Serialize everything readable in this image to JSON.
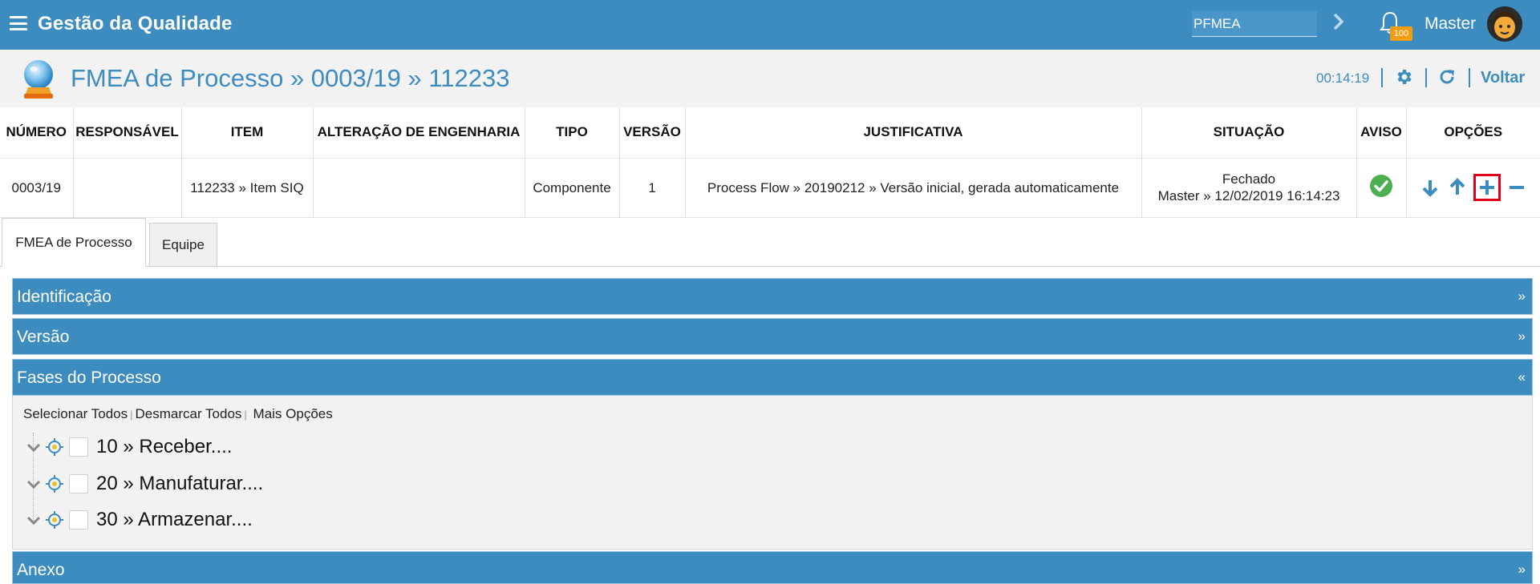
{
  "app": {
    "title": "Gestão da Qualidade",
    "module_value": "PFMEA",
    "notification_count": "100",
    "user_name": "Master"
  },
  "header": {
    "title": "FMEA de Processo » 0003/19 » 112233",
    "timer": "00:14:19",
    "back_label": "Voltar"
  },
  "table": {
    "columns": [
      "NÚMERO",
      "RESPONSÁVEL",
      "ITEM",
      "ALTERAÇÃO DE ENGENHARIA",
      "TIPO",
      "VERSÃO",
      "JUSTIFICATIVA",
      "SITUAÇÃO",
      "AVISO",
      "OPÇÕES"
    ],
    "row": {
      "numero": "0003/19",
      "responsavel": "",
      "item": "112233 » Item SIQ",
      "alteracao": "",
      "tipo": "Componente",
      "versao": "1",
      "justificativa": "Process Flow » 20190212 » Versão inicial, gerada automaticamente",
      "situacao_status": "Fechado",
      "situacao_detail": "Master » 12/02/2019 16:14:23"
    }
  },
  "tabs": [
    {
      "label": "FMEA de Processo",
      "active": true
    },
    {
      "label": "Equipe",
      "active": false
    }
  ],
  "panels": {
    "identificacao": {
      "title": "Identificação",
      "toggle": "»"
    },
    "versao": {
      "title": "Versão",
      "toggle": "»"
    },
    "fases": {
      "title": "Fases do Processo",
      "toggle": "«"
    },
    "anexo": {
      "title": "Anexo",
      "toggle": "»"
    }
  },
  "phase_actions": {
    "select_all": "Selecionar Todos",
    "deselect_all": "Desmarcar Todos",
    "more_options": "Mais Opções"
  },
  "phases": [
    {
      "label": "10 » Receber...."
    },
    {
      "label": "20 » Manufaturar...."
    },
    {
      "label": "30 » Armazenar...."
    }
  ],
  "colors": {
    "primary": "#3d8cc0",
    "badge": "#f39c12",
    "success": "#4caf50",
    "highlight": "#e0001b"
  },
  "icons": [
    "menu-icon",
    "chevron-right-icon",
    "bell-icon",
    "avatar",
    "crystal-ball-icon",
    "gear-icon",
    "refresh-icon",
    "check-circle-icon",
    "arrow-down-icon",
    "arrow-up-icon",
    "plus-icon",
    "minus-icon",
    "chevron-down-icon",
    "target-icon"
  ]
}
